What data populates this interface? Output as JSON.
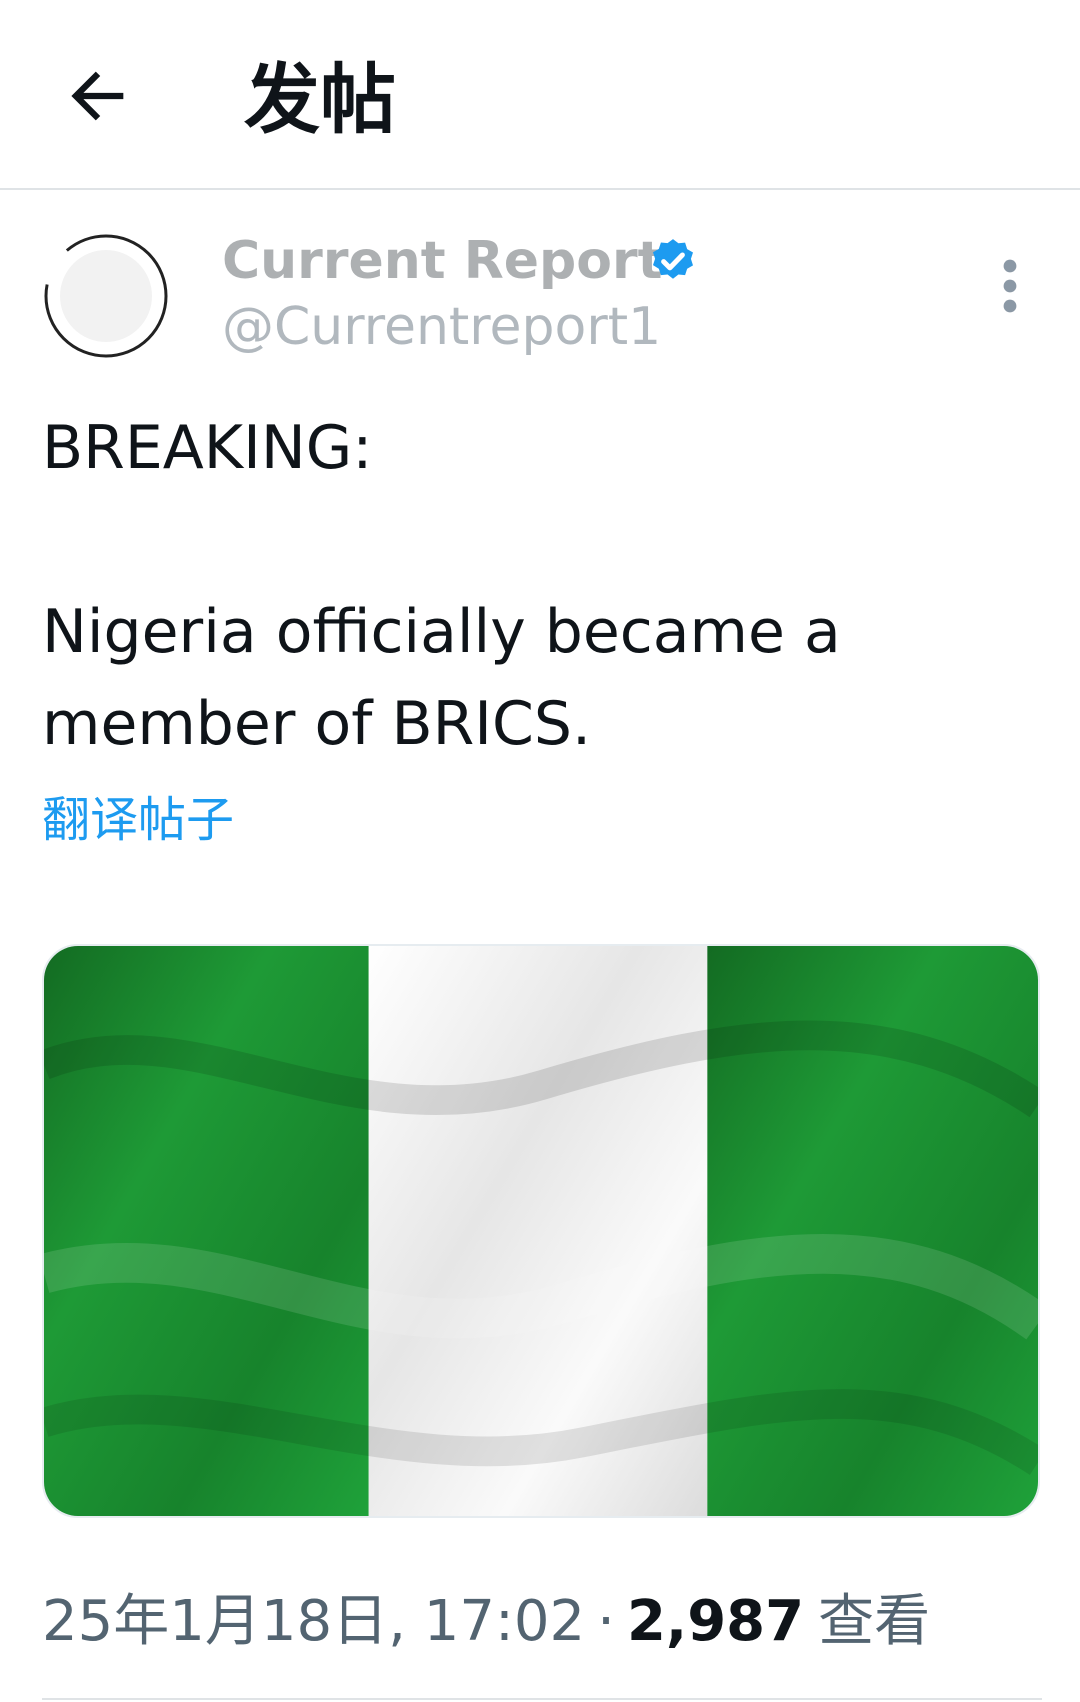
{
  "header": {
    "title": "发帖",
    "back_icon": "arrow-left-icon"
  },
  "author": {
    "name": "Current Report",
    "handle": "@Currentreport1",
    "verified_icon": "verified-badge-icon",
    "verified_color": "#1d9bf0",
    "more_icon": "more-vertical-icon"
  },
  "tweet": {
    "line1": "BREAKING:",
    "line2": "Nigeria officially became a member of BRICS.",
    "translate_label": "翻译帖子"
  },
  "media": {
    "colors": {
      "green": "#1e9a36",
      "white": "#f4f4f4"
    }
  },
  "meta": {
    "timestamp": "25年1月18日, 17:02",
    "separator": "·",
    "views_count": "2,987",
    "views_label": "查看"
  }
}
